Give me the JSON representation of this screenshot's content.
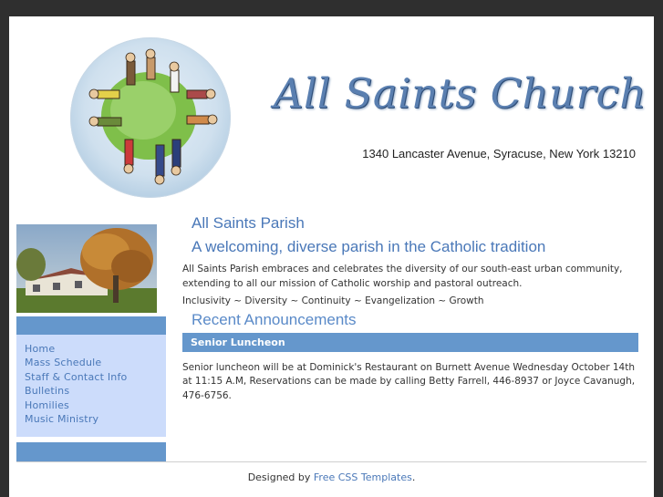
{
  "header": {
    "site_title": "All Saints Church",
    "address": "1340 Lancaster Avenue, Syracuse, New York 13210"
  },
  "sidebar": {
    "items": [
      {
        "label": "Home"
      },
      {
        "label": "Mass Schedule"
      },
      {
        "label": "Staff & Contact Info"
      },
      {
        "label": "Bulletins"
      },
      {
        "label": "Homilies"
      },
      {
        "label": "Music Ministry"
      }
    ]
  },
  "main": {
    "heading_1": "All Saints Parish",
    "heading_2": "A welcoming, diverse parish in the Catholic tradition",
    "intro": "All Saints Parish embraces and celebrates the diversity of our south-east urban community, extending to all our mission of Catholic worship and pastoral outreach.",
    "motto": "Inclusivity ~ Diversity ~ Continuity ~ Evangelization ~ Growth",
    "announcements_heading": "Recent Announcements",
    "announcement_title": "Senior Luncheon",
    "announcement_body": "Senior luncheon will be at Dominick's Restaurant on Burnett Avenue Wednesday October 14th at 11:15 A.M, Reservations can be made by calling Betty Farrell, 446-8937 or Joyce Cavanugh, 476-6756."
  },
  "footer": {
    "prefix": "Designed by ",
    "link": "Free CSS Templates",
    "suffix": "."
  },
  "colors": {
    "accent": "#6597cc",
    "nav_bg": "#ccdcfb",
    "link": "#4a78b8"
  }
}
